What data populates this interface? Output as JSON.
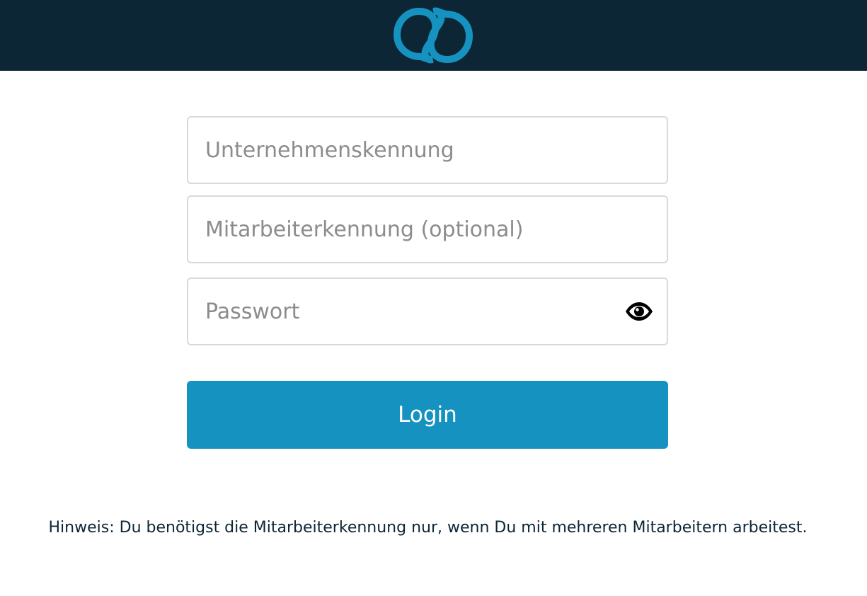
{
  "header": {
    "logo_icon": "infinity-logo-icon",
    "background_color": "#0c2636",
    "logo_color": "#1592c0"
  },
  "form": {
    "company_id": {
      "placeholder": "Unternehmenskennung",
      "value": ""
    },
    "employee_id": {
      "placeholder": "Mitarbeiterkennung (optional)",
      "value": ""
    },
    "password": {
      "placeholder": "Passwort",
      "value": "",
      "toggle_icon": "eye-icon"
    },
    "login_label": "Login",
    "button_color": "#1592c0"
  },
  "note": "Hinweis: Du benötigst die Mitarbeiterkennung nur, wenn Du mit mehreren Mitarbeitern arbeitest."
}
